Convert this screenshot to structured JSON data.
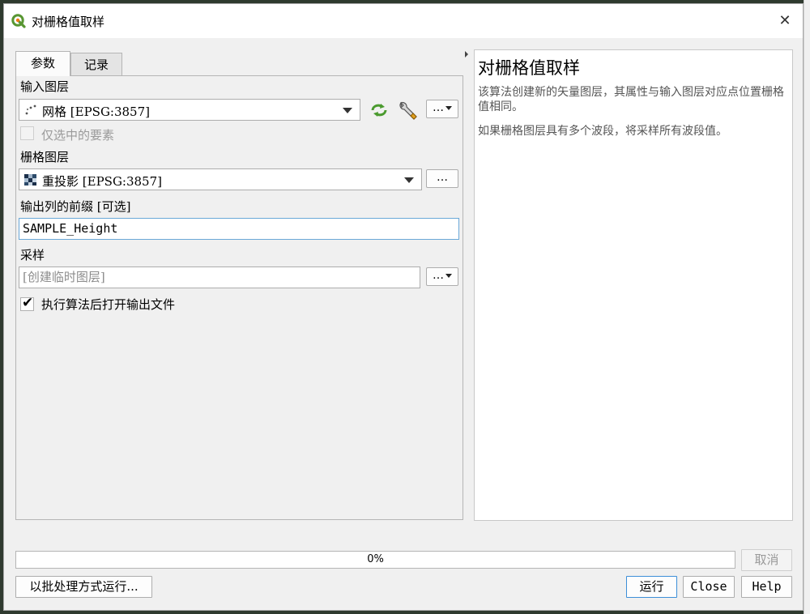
{
  "window": {
    "title": "对栅格值取样",
    "close_glyph": "✕"
  },
  "tabs": [
    {
      "label": "参数"
    },
    {
      "label": "记录"
    }
  ],
  "params": {
    "input_layer": {
      "label": "输入图层",
      "value": "网格 [EPSG:3857]"
    },
    "selected_only": {
      "label": "仅选中的要素",
      "checked": false
    },
    "raster_layer": {
      "label": "栅格图层",
      "value": "重投影 [EPSG:3857]"
    },
    "prefix": {
      "label": "输出列的前缀 [可选]",
      "value": "SAMPLE_Height"
    },
    "sampled": {
      "label": "采样",
      "placeholder": "[创建临时图层]"
    },
    "open_output": {
      "label": "执行算法后打开输出文件",
      "checked": true
    },
    "dots_label": "…"
  },
  "help": {
    "title": "对栅格值取样",
    "para1": "该算法创建新的矢量图层，其属性与输入图层对应点位置栅格值相同。",
    "para2": "如果栅格图层具有多个波段，将采样所有波段值。"
  },
  "progress": {
    "value": 0,
    "text": "0%"
  },
  "buttons": {
    "cancel": "取消",
    "batch": "以批处理方式运行...",
    "run": "运行",
    "close": "Close",
    "help": "Help"
  },
  "colors": {
    "accent": "#3d8fd8",
    "qgis_green": "#589632",
    "qgis_yellow": "#ee7913"
  }
}
